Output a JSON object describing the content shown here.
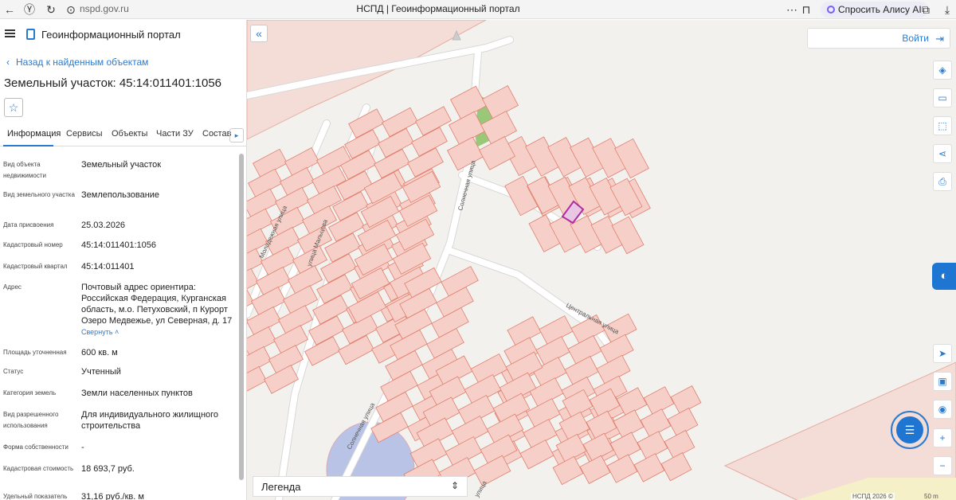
{
  "browser": {
    "url": "nspd.gov.ru",
    "tab_title": "НСПД | Геоинформационный портал",
    "alice": "Спросить Алису AI"
  },
  "app": {
    "title": "Геоинформационный портал",
    "back_link": "Назад к найденным объектам",
    "object_title": "Земельный участок: 45:14:011401:1056"
  },
  "tabs": [
    "Информация",
    "Сервисы",
    "Объекты",
    "Части ЗУ",
    "Состав"
  ],
  "info_rows": [
    {
      "key": "Вид объекта недвижимости",
      "value": "Земельный участок"
    },
    {
      "key": "Вид земельного участка",
      "value": "Землепользование"
    },
    {
      "key": "Дата присвоения",
      "value": "25.03.2026"
    },
    {
      "key": "Кадастровый номер",
      "value": "45:14:011401:1056"
    },
    {
      "key": "Кадастровый квартал",
      "value": "45:14:011401"
    },
    {
      "key": "Адрес",
      "value": "Почтовый адрес ориентира: Российская Федерация, Курганская область, м.о. Петуховский, п Курорт Озеро Медвежье, ул Северная, д. 17",
      "link": "Свернуть"
    },
    {
      "key": "Площадь уточненная",
      "value": "600 кв. м"
    },
    {
      "key": "Статус",
      "value": "Учтенный"
    },
    {
      "key": "Категория земель",
      "value": "Земли населенных пунктов"
    },
    {
      "key": "Вид разрешенного использования",
      "value": "Для индивидуального жилищного строительства"
    },
    {
      "key": "Форма собственности",
      "value": "-"
    },
    {
      "key": "Кадастровая стоимость",
      "value": "18 693,7 руб."
    },
    {
      "key": "Удельный показатель",
      "value": "31,16 руб./кв. м"
    }
  ],
  "map": {
    "login": "Войти",
    "legend": "Легенда",
    "attribution": "НСПД 2026 ©",
    "scale": "50 m",
    "streets": [
      "Молодежная улица",
      "улица Мальцева",
      "Солнечная улица",
      "Центральная улица",
      "Солнечная улица",
      "улица"
    ]
  },
  "colors": {
    "accent": "#2a7bd0",
    "parcel_fill": "#f6d0c8",
    "parcel_stroke": "#e07f6e",
    "selected": "#b02da0"
  }
}
